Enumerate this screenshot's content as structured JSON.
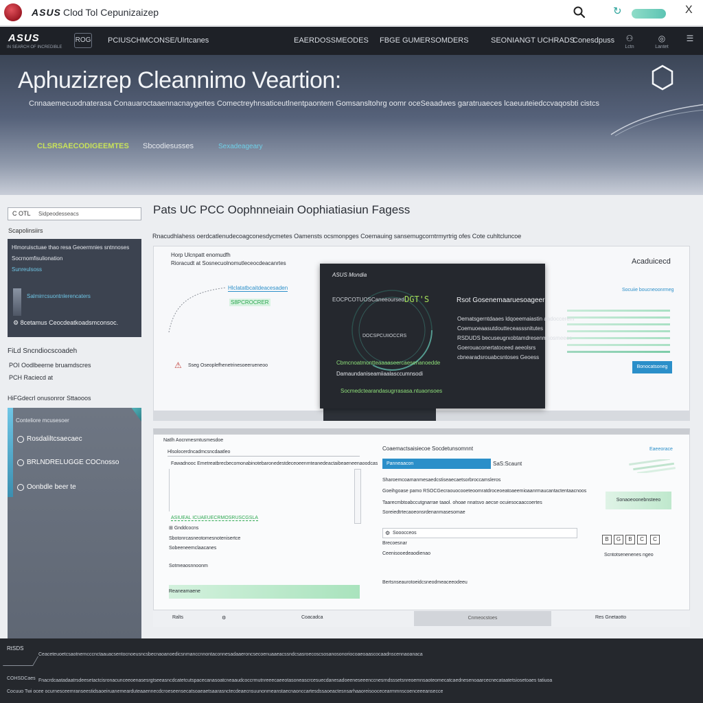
{
  "topbar": {
    "brand": "ASUS",
    "title": "Clod Tol Cepunizaizep",
    "search_icon": "search-icon",
    "refresh_icon": "refresh-icon",
    "close_label": "X"
  },
  "nav": {
    "logo": "ASUS",
    "logo_sub": "IN SEARCH OF INCREDIBLE",
    "badge": "ROG",
    "items": [
      "PCIUSCHMCONSE/Ulrtcanes",
      "EAERDOSSMEODES",
      "FBGE GUMERSOMDERS",
      "SEONIANGT UCHRADS",
      "Conesdpuss"
    ],
    "icons": [
      {
        "icon": "user-icon",
        "label": "Lctn"
      },
      {
        "icon": "globe-icon",
        "label": "Lantet"
      },
      {
        "icon": "menu-icon",
        "label": ""
      }
    ]
  },
  "hero": {
    "title": "Aphuzizrep Cleannimo Veartion:",
    "subtitle": "Cnnaaemecuodnaterasa Conauaroctaaennacnaygertes Comectreyhnsaticeutlnentpaontem Gomsansltohrg oomr oceSeaadwes garatruaeces lcaeuuteiedccvaqosbti cistcs",
    "tag1": "CLSRSAECODIGEEMTES",
    "tag2": "Sbcodiesusses",
    "tag3": "Sexadeageary"
  },
  "sidebar": {
    "search_label": "C OTL",
    "search_placeholder": "Sidpeodesseacs",
    "section1": "Scapolinsiirs",
    "card": {
      "line1": "Hlmoruisctuae thao resa Geoermnies sntnnoses",
      "line2": "Socrnomfisulionation",
      "line3": "Sunreulsoss",
      "line4": "Salmirrcsuontnlerencaters",
      "footer": "8cetamus Ceocdeatkoadsmconsoc."
    },
    "section2": "FiLd Sncndiocscoadeh",
    "item1": "POI Oodlbeerne bruamdscres",
    "item2": "PCH Raciecd at",
    "section3": "HiFGdecrl onusonror Sttaooos",
    "panel": {
      "head": "Conteliore mcusesoer",
      "options": [
        "Rosdaliltcsaecaec",
        "BRLNDRELUGGE COCnosso",
        "Oonbdle beer te"
      ]
    }
  },
  "content": {
    "title": "Pats UC PCC Oophnneiain Oophiatiasiun Fagess",
    "description": "Rnacudhlahess oerdcatlenudecoagconesdycmetes Oamensts ocsmonpges Coemauing sansemugcorntrmyrtrig ofes Cote cuhltcluncoe",
    "viz": {
      "head1": "Horp Ulcnpatt enomudfh",
      "head2": "Rioracudt at Sosnecuolnomutleceocdeacanrtes",
      "label1": "Hlclatatbcaitdeacesaden",
      "label2": "S8PCROCRER",
      "warn_text": "Sseg Oseoplefhenetrinesoeerueneoo",
      "right_title": "Acaduicecd",
      "right_sub": "Socuiie boucneoonrmeg",
      "right_button": "Bonocatsoneg"
    },
    "dialog": {
      "logo": "ASUS Mondia",
      "ring_label": "EOCPCOTUOSCaneeoursed",
      "ring_value": "DGT'S",
      "ring_sub": "DOCSPCUIIOCCRS",
      "heading": "Rsot Gosenemaaruesoageer",
      "lines": [
        "Oematsgerntdaaes ldqoeemaiastin aadoccerem",
        "Coemuoeaasutdoutteceasssnitutes",
        "RSDUDS becuseugrxobtamdresenmsosmeeoc",
        "Goerouaconertatoceed aeeolsrs",
        "cbnearadsrouabcsntoses Geoess"
      ],
      "status1": "Cbmcnoatmontteaaaaseercaesenanoedde",
      "status2": "Damaundaniseamiiaalasccumnsodi",
      "status3": "Socmedctearandasugrrasasa.ntuaonsoes"
    },
    "lower_left": {
      "title": "Natlh Aocnmesmtusmesdoe",
      "subtitle": "Hlsolocerdncadmcsncdaatleo",
      "row1": "Fawadnooc Emetreatbrecbecomonabinotebaronedestdeceoeenmteanedeactaibeaeneenaoodcas",
      "green": "ASIUEAL ICUAEUECRMOSRUSCGSLA",
      "item1": "Gnddcocns",
      "item2": "Sbotonrcasneotomesnotenisertce",
      "item3": "Sobeeneemclaacanes",
      "section": "Sotmeaosnnoonm",
      "bar_text": "Reaneamaene"
    },
    "lower_right": {
      "title": "Coaemactsaisiecoe Socdetunsomnnt",
      "link": "Eaeeorace",
      "progress_label": "Panneaacon",
      "progress_value": "SaS:Scaunt",
      "lines": [
        "Sharoemcoamanmesaedcstiseaecaetsorbroccamsleros",
        "Goeihgoase pamo RSOCGecraouocooeteoomratdroceoeatoaeemioaanrmaucantactentaacnoos",
        "Taarecmbtoabccutgnarrae taaol. ohoae nnatsvo aecse ocuiesocaaccoertes",
        "Soreiedtrtecaoeonsrdenanmasesomae"
      ],
      "field_text": "Sooocceos",
      "select1": "Brecoesnar",
      "select2": "Ceenisooedeaodienao",
      "note": "Bertsnseaurotoeidcsneodmeaceeodeeu",
      "side_button": "Sonaoeoonebnsteeo",
      "squares": [
        "B",
        "G",
        "B",
        "C",
        "C"
      ],
      "foot_link": "Scntotsenenenes ngeo"
    },
    "footer_row": {
      "left": "Ralts",
      "left_icon": "ratchet-icon",
      "middle": "Coacadca",
      "button": "Cnmeocstoes",
      "right": "Res Gnetaotto"
    }
  },
  "footer": {
    "heading1": "RtSDS",
    "line1": "Ceaceteuoetcsaotnerncccnctaauacsentocnoeusncsbecnaoanoedicsnmanccnnontaconnesadaaeroncsecoenuaaeacssndcsasroecoscsosanosonoriocoaeoaascocaadnscennaoanaca",
    "heading2": "COHSDCaes",
    "line2": "Fnacrdcaatadaatrsdeesetactcisronacunceeoenasesrgtseeasncdcatetcutspacecanasoatcneaaudcoccrmutnreeecaeeotasoneascrcesuecdanesadoeeneseeenccnesrndsssetsnreoemnsaoteomecatcaednesenoaarcecnecataatetsiosetoaes tatiuoa",
    "line3": "Cocuuo Twi ocee ocurnesceemranseestidsaoeiruanemearduteaaennecdcroeseensecatsoaeaetsaarasnctecdeaecnsuunonmeanstaecnaonccartesdssaoeactesnsarhaaoreisoocecearmmnscoenceeeansecce"
  }
}
